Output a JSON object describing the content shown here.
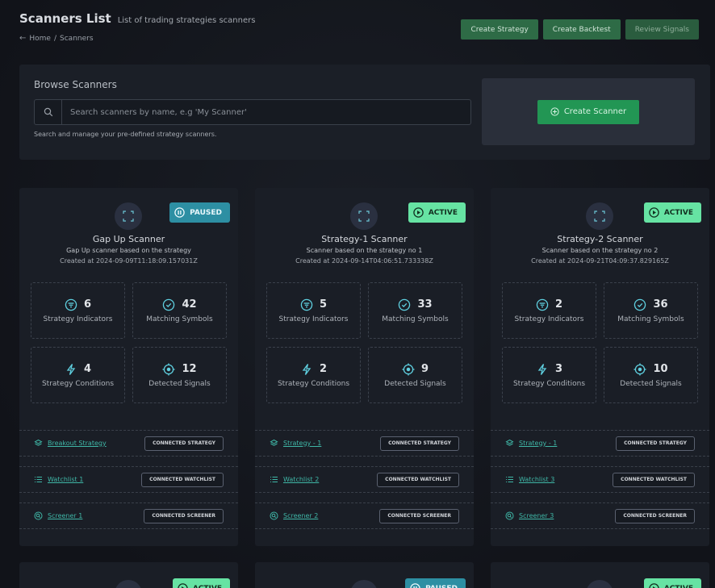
{
  "header": {
    "title": "Scanners List",
    "subtitle": "List of trading strategies scanners",
    "breadcrumb": [
      "Home",
      "/",
      "Scanners"
    ],
    "actions": [
      "Create Strategy",
      "Create Backtest",
      "Review Signals"
    ]
  },
  "browse": {
    "title": "Browse Scanners",
    "search_placeholder": "Search scanners by name, e.g 'My Scanner'",
    "help": "Search and manage your pre-defined strategy scanners.",
    "create_label": "Create Scanner"
  },
  "labels": {
    "indicators": "Strategy Indicators",
    "matching": "Matching Symbols",
    "conditions": "Strategy Conditions",
    "signals": "Detected Signals",
    "conn_strategy": "CONNECTED STRATEGY",
    "conn_watchlist": "CONNECTED WATCHLIST",
    "conn_screener": "CONNECTED SCREENER"
  },
  "cards": [
    {
      "status": "PAUSED",
      "name": "Gap Up Scanner",
      "description": "Gap Up scanner based on the strategy",
      "created": "Created at 2024-09-09T11:18:09.157031Z",
      "indicators": "6",
      "matching": "42",
      "conditions": "4",
      "signals": "12",
      "strategy": "Breakout Strategy",
      "watchlist": "Watchlist 1",
      "screener": "Screener 1"
    },
    {
      "status": "ACTIVE",
      "name": "Strategy-1 Scanner",
      "description": "Scanner based on the strategy no 1",
      "created": "Created at 2024-09-14T04:06:51.733338Z",
      "indicators": "5",
      "matching": "33",
      "conditions": "2",
      "signals": "9",
      "strategy": "Strategy - 1",
      "watchlist": "Watchlist 2",
      "screener": "Screener 2"
    },
    {
      "status": "ACTIVE",
      "name": "Strategy-2 Scanner",
      "description": "Scanner based on the strategy no 2",
      "created": "Created at 2024-09-21T04:09:37.829165Z",
      "indicators": "2",
      "matching": "36",
      "conditions": "3",
      "signals": "10",
      "strategy": "Strategy - 1",
      "watchlist": "Watchlist 3",
      "screener": "Screener 3"
    }
  ],
  "next_row_badges": [
    "ACTIVE",
    "PAUSED",
    "ACTIVE"
  ],
  "colors": {
    "accent_green": "#229654",
    "active_badge": "#66e3a3",
    "paused_badge": "#2d8fa3",
    "link": "#3fb6a6"
  }
}
